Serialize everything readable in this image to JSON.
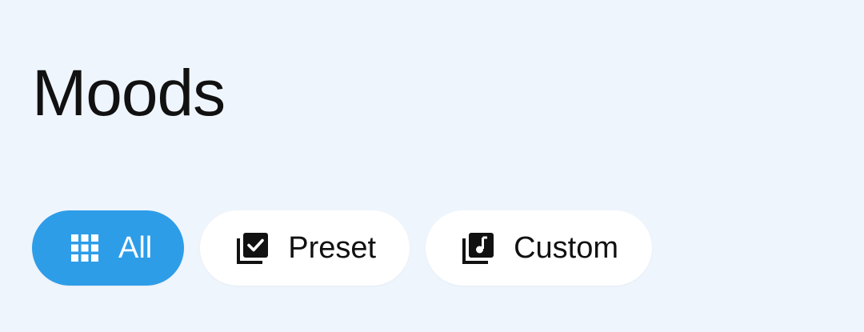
{
  "page": {
    "title": "Moods"
  },
  "filters": {
    "items": [
      {
        "label": "All",
        "icon": "grid-icon",
        "selected": true
      },
      {
        "label": "Preset",
        "icon": "library-check-icon",
        "selected": false
      },
      {
        "label": "Custom",
        "icon": "library-music-icon",
        "selected": false
      }
    ]
  },
  "colors": {
    "background": "#eff5fd",
    "accent": "#2e9de8",
    "chip_background": "#ffffff",
    "text": "#111111"
  }
}
